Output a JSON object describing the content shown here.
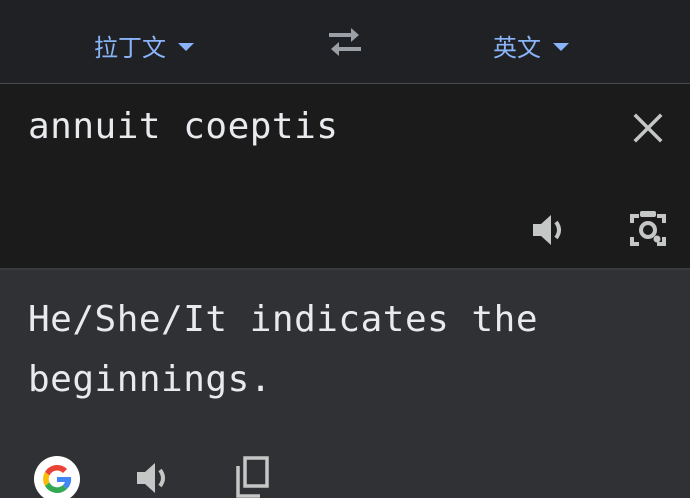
{
  "languages": {
    "source": "拉丁文",
    "target": "英文"
  },
  "source": {
    "text": "annuit coeptis"
  },
  "result": {
    "text": "He/She/It indicates the beginnings."
  },
  "icons": {
    "swap": "swap-languages-icon",
    "clear": "close-icon",
    "source_speak": "speaker-icon",
    "camera": "camera-lens-icon",
    "brand": "google-logo",
    "result_speak": "speaker-icon",
    "copy": "copy-icon"
  },
  "colors": {
    "accent": "#8ab4f8",
    "background": "#1b1b1c",
    "result_background": "#303134",
    "text": "#e8eaed",
    "icon": "#c4c7c5"
  }
}
